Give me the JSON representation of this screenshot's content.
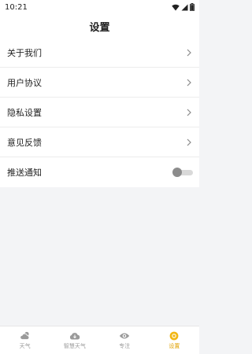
{
  "status_bar": {
    "time": "10:21"
  },
  "header": {
    "title": "设置"
  },
  "settings": {
    "items": [
      {
        "label": "关于我们"
      },
      {
        "label": "用户协议"
      },
      {
        "label": "隐私设置"
      },
      {
        "label": "意见反馈"
      },
      {
        "label": "推送通知",
        "toggle_on": false
      }
    ]
  },
  "tabbar": {
    "tabs": [
      {
        "label": "天气",
        "icon": "cloud-sun-icon",
        "active": false
      },
      {
        "label": "智慧天气",
        "icon": "cloud-download-icon",
        "active": false
      },
      {
        "label": "专注",
        "icon": "eye-icon",
        "active": false
      },
      {
        "label": "设置",
        "icon": "settings-icon",
        "active": true
      }
    ],
    "active_color": "#e0a100",
    "inactive_color": "#9a9a9a"
  }
}
